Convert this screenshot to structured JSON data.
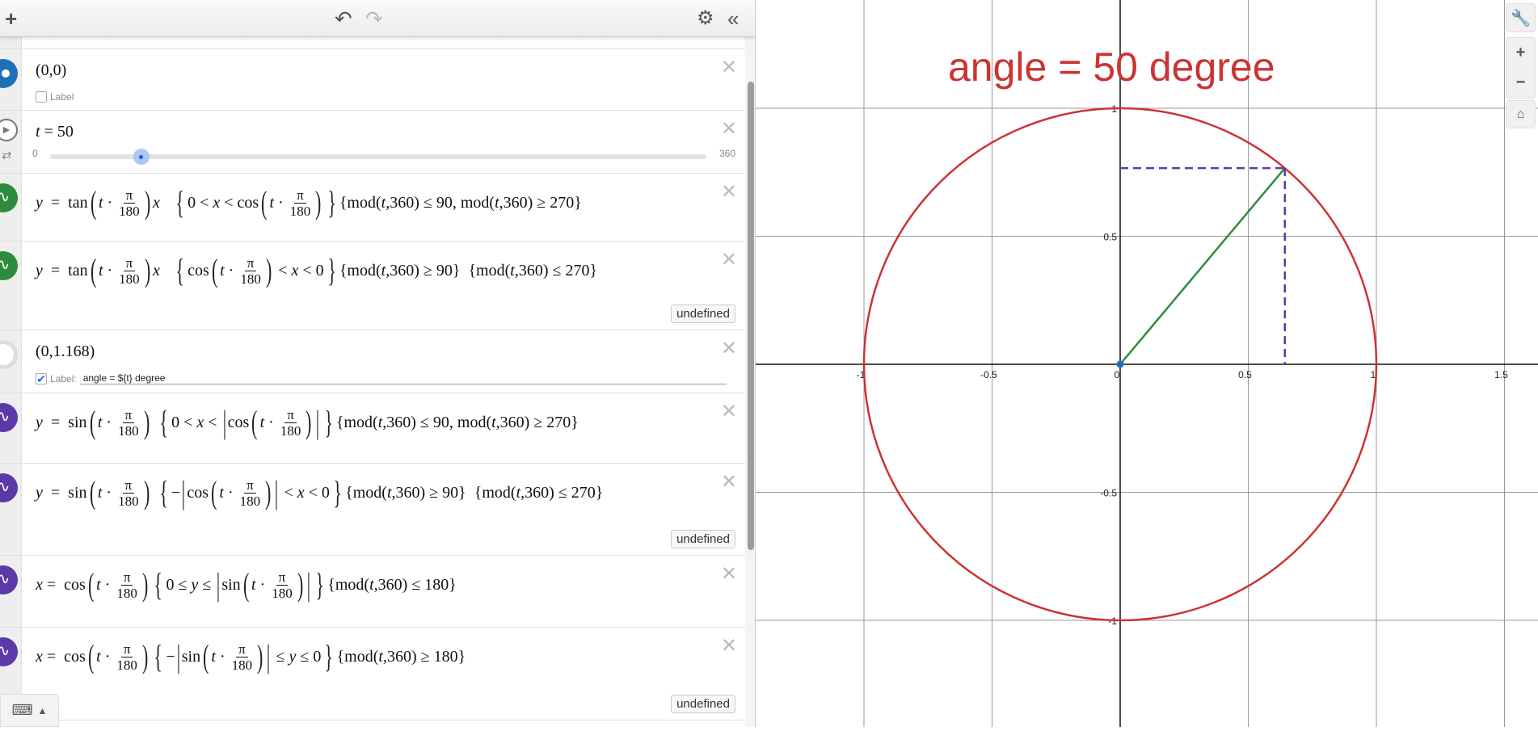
{
  "toolbar": {
    "add": "+",
    "undo": "↶",
    "redo": "↷",
    "settings": "⚙",
    "collapse": "«"
  },
  "rows": [
    {
      "kind": "point",
      "marker": "#1f6fb8",
      "expr": [
        {
          "s": "(0,0)"
        }
      ],
      "label_text": "Label",
      "label_checked": false
    },
    {
      "kind": "slider",
      "expr": [
        {
          "i": "t"
        },
        {
          "s": " = 50"
        }
      ],
      "min": "0",
      "max": "360",
      "value": 50,
      "range": [
        0,
        360
      ]
    },
    {
      "kind": "func",
      "marker": "#2e8b3e",
      "expr": [
        {
          "i": "y"
        },
        {
          "s": "  =  tan"
        },
        {
          "d": "("
        },
        {
          "i": "t"
        },
        {
          "s": " · "
        },
        {
          "f": [
            "π",
            "180"
          ]
        },
        {
          "d": ")"
        },
        {
          "i": "x"
        },
        {
          "s": "   "
        },
        {
          "d": "{"
        },
        {
          "s": "0 < "
        },
        {
          "i": "x"
        },
        {
          "s": " < cos"
        },
        {
          "d": "("
        },
        {
          "i": "t"
        },
        {
          "s": " · "
        },
        {
          "f": [
            "π",
            "180"
          ]
        },
        {
          "d": ")"
        },
        {
          "d": "}"
        },
        {
          "s": "{mod("
        },
        {
          "i": "t"
        },
        {
          "s": ",360) ≤ 90, mod("
        },
        {
          "i": "t"
        },
        {
          "s": ",360) ≥ 270}"
        }
      ]
    },
    {
      "kind": "func",
      "marker": "#2e8b3e",
      "undefined": "undefined",
      "expr": [
        {
          "i": "y"
        },
        {
          "s": "  =  tan"
        },
        {
          "d": "("
        },
        {
          "i": "t"
        },
        {
          "s": " · "
        },
        {
          "f": [
            "π",
            "180"
          ]
        },
        {
          "d": ")"
        },
        {
          "i": "x"
        },
        {
          "s": "   "
        },
        {
          "d": "{"
        },
        {
          "s": "cos"
        },
        {
          "d": "("
        },
        {
          "i": "t"
        },
        {
          "s": " · "
        },
        {
          "f": [
            "π",
            "180"
          ]
        },
        {
          "d": ")"
        },
        {
          "s": " < "
        },
        {
          "i": "x"
        },
        {
          "s": " < 0"
        },
        {
          "d": "}"
        },
        {
          "s": "{mod("
        },
        {
          "i": "t"
        },
        {
          "s": ",360) ≥ 90}  {mod("
        },
        {
          "i": "t"
        },
        {
          "s": ",360) ≤ 270}"
        }
      ]
    },
    {
      "kind": "point",
      "marker": "hollow",
      "expr": [
        {
          "s": "(0,1.168)"
        }
      ],
      "label_text": "Label:",
      "label_checked": true,
      "label_value": "angle = ${t} degree"
    },
    {
      "kind": "func",
      "marker": "#5b3aa8",
      "expr": [
        {
          "i": "y"
        },
        {
          "s": "  =  sin"
        },
        {
          "d": "("
        },
        {
          "i": "t"
        },
        {
          "s": " · "
        },
        {
          "f": [
            "π",
            "180"
          ]
        },
        {
          "d": ")"
        },
        {
          "s": " "
        },
        {
          "d": "{"
        },
        {
          "s": "0 < "
        },
        {
          "i": "x"
        },
        {
          "s": " < "
        },
        {
          "d": "|"
        },
        {
          "s": "cos"
        },
        {
          "d": "("
        },
        {
          "i": "t"
        },
        {
          "s": " · "
        },
        {
          "f": [
            "π",
            "180"
          ]
        },
        {
          "d": ")"
        },
        {
          "d": "|"
        },
        {
          "d": "}"
        },
        {
          "s": "{mod("
        },
        {
          "i": "t"
        },
        {
          "s": ",360) ≤ 90, mod("
        },
        {
          "i": "t"
        },
        {
          "s": ",360) ≥ 270}"
        }
      ]
    },
    {
      "kind": "func",
      "marker": "#5b3aa8",
      "undefined": "undefined",
      "expr": [
        {
          "i": "y"
        },
        {
          "s": "  =  sin"
        },
        {
          "d": "("
        },
        {
          "i": "t"
        },
        {
          "s": " · "
        },
        {
          "f": [
            "π",
            "180"
          ]
        },
        {
          "d": ")"
        },
        {
          "s": " "
        },
        {
          "d": "{"
        },
        {
          "s": "−"
        },
        {
          "d": "|"
        },
        {
          "s": "cos"
        },
        {
          "d": "("
        },
        {
          "i": "t"
        },
        {
          "s": " · "
        },
        {
          "f": [
            "π",
            "180"
          ]
        },
        {
          "d": ")"
        },
        {
          "d": "|"
        },
        {
          "s": " < "
        },
        {
          "i": "x"
        },
        {
          "s": " < 0"
        },
        {
          "d": "}"
        },
        {
          "s": "{mod("
        },
        {
          "i": "t"
        },
        {
          "s": ",360) ≥ 90}  {mod("
        },
        {
          "i": "t"
        },
        {
          "s": ",360) ≤ 270}"
        }
      ]
    },
    {
      "kind": "func",
      "marker": "#5b3aa8",
      "expr": [
        {
          "i": "x"
        },
        {
          "s": " =  cos"
        },
        {
          "d": "("
        },
        {
          "i": "t"
        },
        {
          "s": " · "
        },
        {
          "f": [
            "π",
            "180"
          ]
        },
        {
          "d": ")"
        },
        {
          "d": "{"
        },
        {
          "s": "0 ≤ "
        },
        {
          "i": "y"
        },
        {
          "s": " ≤ "
        },
        {
          "d": "|"
        },
        {
          "s": "sin"
        },
        {
          "d": "("
        },
        {
          "i": "t"
        },
        {
          "s": " · "
        },
        {
          "f": [
            "π",
            "180"
          ]
        },
        {
          "d": ")"
        },
        {
          "d": "|"
        },
        {
          "d": "}"
        },
        {
          "s": "{mod("
        },
        {
          "i": "t"
        },
        {
          "s": ",360) ≤ 180}"
        }
      ]
    },
    {
      "kind": "func",
      "marker": "#5b3aa8",
      "undefined": "undefined",
      "expr": [
        {
          "i": "x"
        },
        {
          "s": " =  cos"
        },
        {
          "d": "("
        },
        {
          "i": "t"
        },
        {
          "s": " · "
        },
        {
          "f": [
            "π",
            "180"
          ]
        },
        {
          "d": ")"
        },
        {
          "d": "{"
        },
        {
          "s": "−"
        },
        {
          "d": "|"
        },
        {
          "s": "sin"
        },
        {
          "d": "("
        },
        {
          "i": "t"
        },
        {
          "s": " · "
        },
        {
          "f": [
            "π",
            "180"
          ]
        },
        {
          "d": ")"
        },
        {
          "d": "|"
        },
        {
          "s": " ≤ "
        },
        {
          "i": "y"
        },
        {
          "s": " ≤ 0"
        },
        {
          "d": "}"
        },
        {
          "s": "{mod("
        },
        {
          "i": "t"
        },
        {
          "s": ",360) ≥ 180}"
        }
      ]
    }
  ],
  "graph": {
    "title": "angle = 50 degree",
    "title_color": "#cc3333",
    "angle_deg": 50,
    "x_ticks": [
      "-1",
      "-0.5",
      "0",
      "0.5",
      "1",
      "1.5"
    ],
    "x_tick_values": [
      -1,
      -0.5,
      0,
      0.5,
      1,
      1.5
    ],
    "y_ticks": [
      "1",
      "0.5",
      "-0.5",
      "-1"
    ],
    "y_tick_values": [
      1,
      0.5,
      -0.5,
      -1
    ],
    "circle_color": "#cc3333",
    "segment_color": "#2e8b3e",
    "dash_color": "#5b3aa8",
    "point_color": "#1f6fb8",
    "tools": {
      "settings": "wrench",
      "zoom_in": "+",
      "zoom_out": "−",
      "home": "home"
    }
  }
}
